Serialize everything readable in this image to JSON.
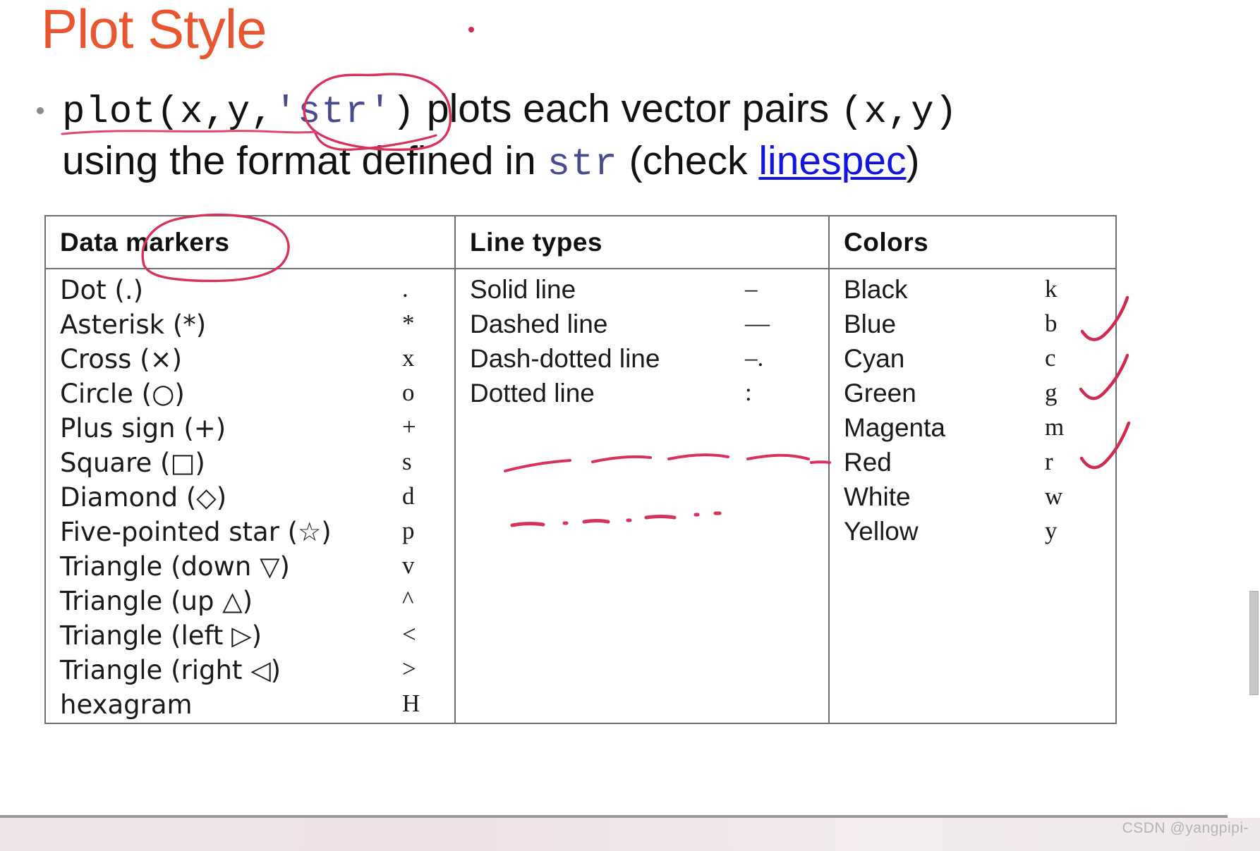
{
  "slide": {
    "title": "Plot Style",
    "bullet": {
      "line1_pre_code": "plot(x,y,",
      "line1_str_code": "'str'",
      "line1_post_code": ")",
      "line1_text": " plots each vector pairs ",
      "line1_pair_code": "(x,y)",
      "line2_pre": "using the format defined in ",
      "line2_str_code": "str",
      "line2_mid": " (check ",
      "line2_link": "linespec",
      "line2_post": ")"
    }
  },
  "table": {
    "columns": [
      {
        "header": "Data markers",
        "rows": [
          {
            "label": "Dot (.)",
            "code": "."
          },
          {
            "label": "Asterisk (*)",
            "code": "*"
          },
          {
            "label": "Cross (×)",
            "code": "x"
          },
          {
            "label": "Circle (○)",
            "code": "o"
          },
          {
            "label": "Plus sign (+)",
            "code": "+"
          },
          {
            "label": "Square (□)",
            "code": "s"
          },
          {
            "label": "Diamond (◇)",
            "code": "d"
          },
          {
            "label": "Five-pointed star (☆)",
            "code": "p"
          },
          {
            "label": "Triangle (down ▽)",
            "code": "v"
          },
          {
            "label": "Triangle (up △)",
            "code": "^"
          },
          {
            "label": "Triangle (left ▷)",
            "code": "<"
          },
          {
            "label": "Triangle (right ◁)",
            "code": ">"
          },
          {
            "label": "hexagram",
            "code": "H"
          }
        ]
      },
      {
        "header": "Line types",
        "rows": [
          {
            "label": "Solid line",
            "code": "–"
          },
          {
            "label": "Dashed line",
            "code": "––"
          },
          {
            "label": "Dash-dotted line",
            "code": "–."
          },
          {
            "label": "Dotted line",
            "code": ":"
          }
        ]
      },
      {
        "header": "Colors",
        "rows": [
          {
            "label": "Black",
            "code": "k"
          },
          {
            "label": "Blue",
            "code": "b"
          },
          {
            "label": "Cyan",
            "code": "c"
          },
          {
            "label": "Green",
            "code": "g"
          },
          {
            "label": "Magenta",
            "code": "m"
          },
          {
            "label": "Red",
            "code": "r"
          },
          {
            "label": "White",
            "code": "w"
          },
          {
            "label": "Yellow",
            "code": "y"
          }
        ]
      }
    ]
  },
  "annotations": {
    "ink_color": "#d6325c",
    "marks": [
      "circle-around-str",
      "underline-under-plot-xy",
      "circle-around-data-markers",
      "handdrawn-dashed-line",
      "handdrawn-dash-dotted-line",
      "check-blue",
      "check-green",
      "check-red",
      "stray-dot-top"
    ]
  },
  "footer": {
    "watermark": "CSDN @yangpipi-"
  },
  "colors": {
    "title": "#e8552f",
    "link": "#1414e0",
    "mono_str": "#4a4a8f",
    "ink": "#d6325c",
    "table_border": "#6d6d6d"
  }
}
